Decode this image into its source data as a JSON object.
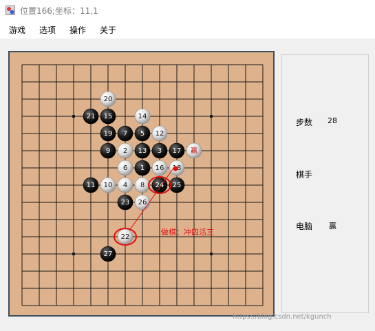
{
  "window": {
    "title": "位置166;坐标：11,1"
  },
  "menu": [
    "游戏",
    "选项",
    "操作",
    "关于"
  ],
  "board": {
    "grid_size": 15,
    "stones": [
      {
        "num": 1,
        "color": "black",
        "col": 7,
        "row": 6
      },
      {
        "num": 2,
        "color": "white",
        "col": 6,
        "row": 5
      },
      {
        "num": 3,
        "color": "black",
        "col": 8,
        "row": 5
      },
      {
        "num": 4,
        "color": "white",
        "col": 6,
        "row": 7
      },
      {
        "num": 5,
        "color": "black",
        "col": 7,
        "row": 4
      },
      {
        "num": 6,
        "color": "white",
        "col": 6,
        "row": 6
      },
      {
        "num": 7,
        "color": "black",
        "col": 6,
        "row": 4
      },
      {
        "num": 8,
        "color": "white",
        "col": 7,
        "row": 7
      },
      {
        "num": 9,
        "color": "black",
        "col": 5,
        "row": 5
      },
      {
        "num": 10,
        "color": "white",
        "col": 5,
        "row": 7
      },
      {
        "num": 11,
        "color": "black",
        "col": 4,
        "row": 7
      },
      {
        "num": 12,
        "color": "white",
        "col": 8,
        "row": 4
      },
      {
        "num": 13,
        "color": "black",
        "col": 7,
        "row": 5
      },
      {
        "num": 14,
        "color": "white",
        "col": 7,
        "row": 3
      },
      {
        "num": 15,
        "color": "black",
        "col": 5,
        "row": 3
      },
      {
        "num": 16,
        "color": "white",
        "col": 8,
        "row": 6
      },
      {
        "num": 17,
        "color": "black",
        "col": 9,
        "row": 5
      },
      {
        "num": 18,
        "color": "white",
        "col": 9,
        "row": 6
      },
      {
        "num": 19,
        "color": "black",
        "col": 5,
        "row": 4
      },
      {
        "num": 20,
        "color": "white",
        "col": 5,
        "row": 2
      },
      {
        "num": 21,
        "color": "black",
        "col": 4,
        "row": 3
      },
      {
        "num": 22,
        "color": "white",
        "col": 6,
        "row": 10
      },
      {
        "num": 23,
        "color": "black",
        "col": 6,
        "row": 8
      },
      {
        "num": 24,
        "color": "black",
        "col": 8,
        "row": 7
      },
      {
        "num": 25,
        "color": "black",
        "col": 9,
        "row": 7
      },
      {
        "num": 26,
        "color": "white",
        "col": 7,
        "row": 8
      },
      {
        "num": 27,
        "color": "black",
        "col": 5,
        "row": 11
      }
    ],
    "win_marker": {
      "label": "赢",
      "col": 10,
      "row": 5
    },
    "highlighted_moves": [
      22,
      24
    ],
    "annotation": "做棋：冲四活三",
    "colors": {
      "wood": "#ddb28c",
      "frame": "#3d4e5c",
      "mark": "#e01010"
    }
  },
  "info": {
    "steps_label": "步数",
    "steps_value": "28",
    "player_label": "棋手",
    "computer_label": "电脑",
    "computer_status": "赢"
  },
  "watermark": "https://blog.csdn.net/kgunch"
}
